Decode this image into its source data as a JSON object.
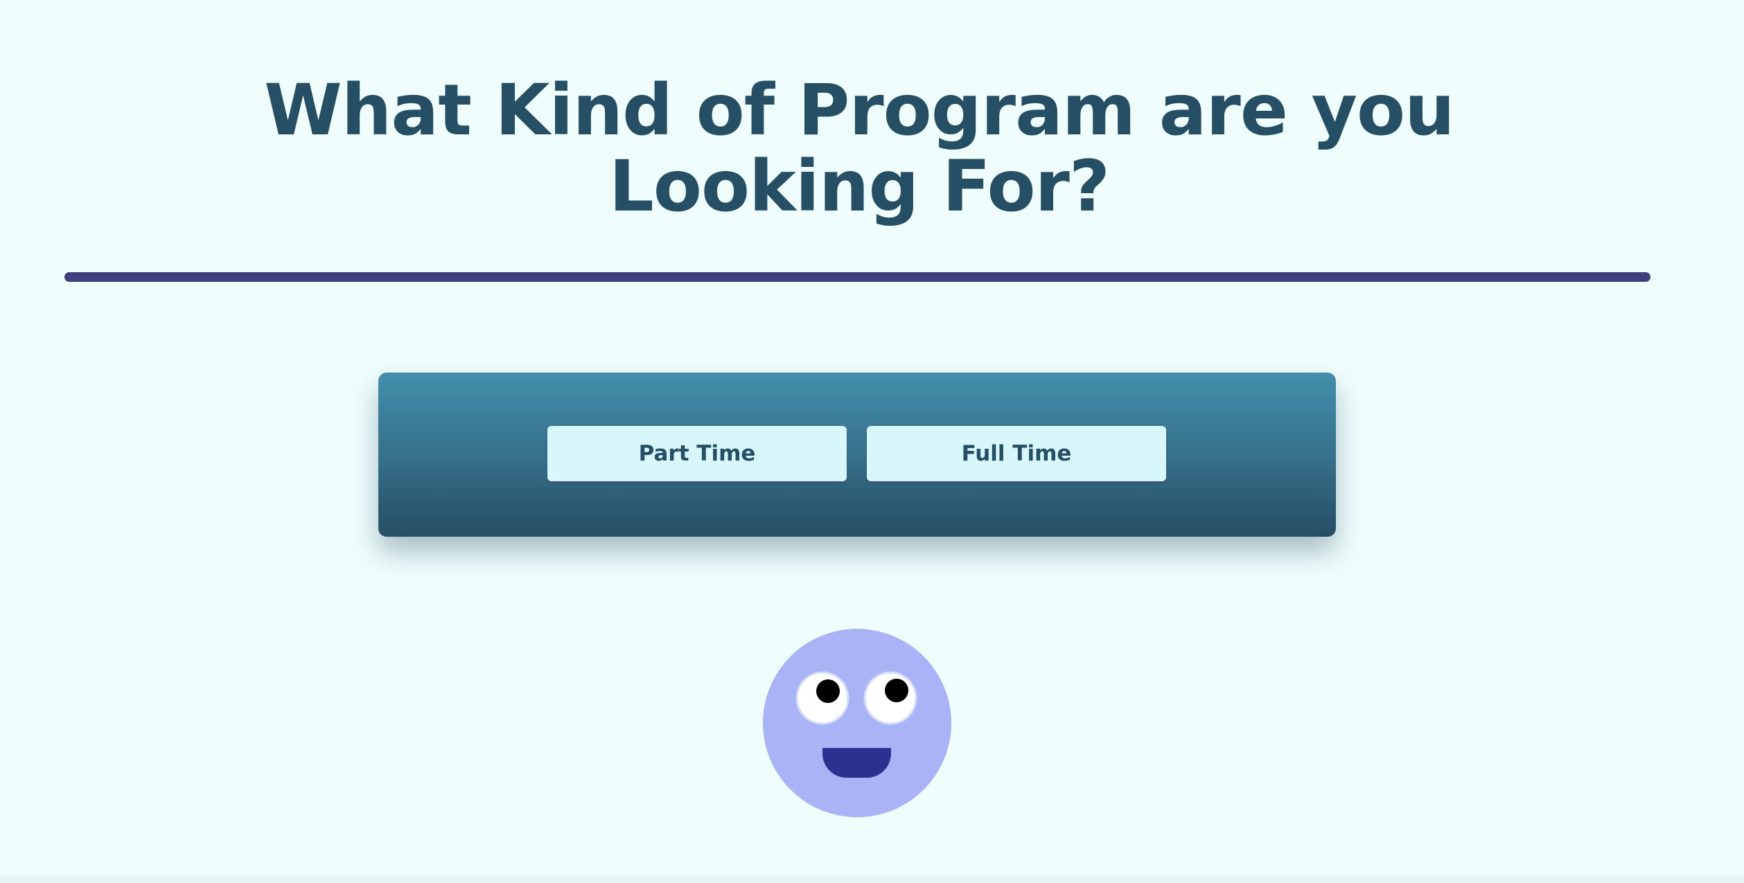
{
  "heading": {
    "title": "What Kind of Program are you Looking For?"
  },
  "program_options": {
    "part_time_label": "Part Time",
    "full_time_label": "Full Time"
  },
  "colors": {
    "background": "#effdfc",
    "title_text": "#264e64",
    "divider": "#41407f",
    "panel_top": "#428eab",
    "panel_bottom": "#264e64",
    "button_fill": "#d8f7fb",
    "mascot_face": "#a9b3f6",
    "mascot_mouth": "#2c3190"
  },
  "mascot": {
    "icon": "smiley-face-icon"
  }
}
